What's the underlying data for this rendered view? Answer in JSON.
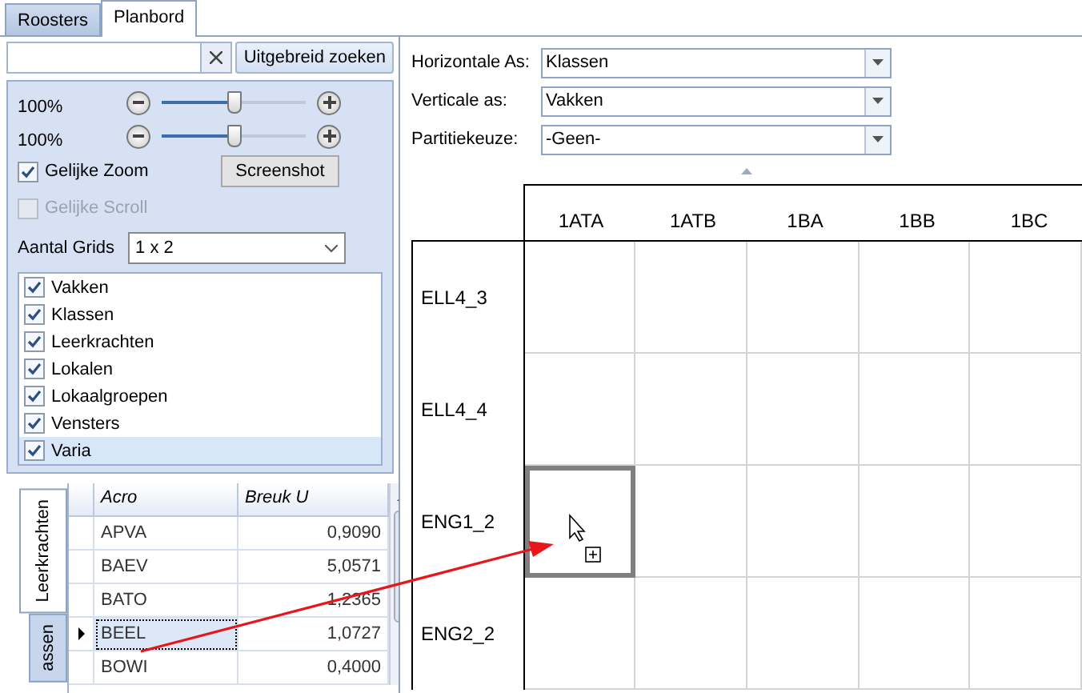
{
  "tabs": [
    {
      "label": "Roosters",
      "selected": false
    },
    {
      "label": "Planbord",
      "selected": true
    }
  ],
  "search": {
    "advanced_button": "Uitgebreid zoeken"
  },
  "zoom": [
    {
      "reading": "100%",
      "level": 0.5
    },
    {
      "reading": "100%",
      "level": 0.5
    }
  ],
  "options": [
    {
      "label": "Gelijke Zoom",
      "checked": true,
      "disabled": false
    },
    {
      "label": "Gelijke Scroll",
      "checked": false,
      "disabled": true
    }
  ],
  "screenshot_button": "Screenshot",
  "grids": {
    "label": "Aantal Grids",
    "value": "1 x 2"
  },
  "layers": [
    {
      "label": "Vakken",
      "checked": true,
      "selected": false
    },
    {
      "label": "Klassen",
      "checked": true,
      "selected": false
    },
    {
      "label": "Leerkrachten",
      "checked": true,
      "selected": false
    },
    {
      "label": "Lokalen",
      "checked": true,
      "selected": false
    },
    {
      "label": "Lokaalgroepen",
      "checked": true,
      "selected": false
    },
    {
      "label": "Vensters",
      "checked": true,
      "selected": false
    },
    {
      "label": "Varia",
      "checked": true,
      "selected": true
    }
  ],
  "side_tabs": [
    {
      "label": "Leerkrachten",
      "selected": true
    },
    {
      "label": "assen",
      "selected": false
    }
  ],
  "table": {
    "columns": [
      "Acro",
      "Breuk U"
    ],
    "rows": [
      {
        "acro": "APVA",
        "breuk": "0,9090",
        "selected": false
      },
      {
        "acro": "BAEV",
        "breuk": "5,0571",
        "selected": false
      },
      {
        "acro": "BATO",
        "breuk": "1,2365",
        "selected": false
      },
      {
        "acro": "BEEL",
        "breuk": "1,0727",
        "selected": true
      },
      {
        "acro": "BOWI",
        "breuk": "0,4000",
        "selected": false
      }
    ]
  },
  "axes": [
    {
      "label": "Horizontale As:",
      "value": "Klassen"
    },
    {
      "label": "Verticale as:",
      "value": "Vakken"
    },
    {
      "label": "Partitiekeuze:",
      "value": "-Geen-"
    }
  ],
  "planboard": {
    "columns": [
      "1ATA",
      "1ATB",
      "1BA",
      "1BB",
      "1BC"
    ],
    "rows": [
      {
        "label": "ELL4_3",
        "cells": [
          {
            "selected": false
          },
          {
            "selected": false
          },
          {
            "selected": false
          },
          {
            "selected": false
          },
          {
            "selected": false
          }
        ]
      },
      {
        "label": "ELL4_4",
        "cells": [
          {
            "selected": false
          },
          {
            "selected": false
          },
          {
            "selected": false
          },
          {
            "selected": false
          },
          {
            "selected": false
          }
        ]
      },
      {
        "label": "ENG1_2",
        "cells": [
          {
            "selected": true
          },
          {
            "selected": false
          },
          {
            "selected": false
          },
          {
            "selected": false
          },
          {
            "selected": false
          }
        ]
      },
      {
        "label": "ENG2_2",
        "cells": [
          {
            "selected": false
          },
          {
            "selected": false
          },
          {
            "selected": false
          },
          {
            "selected": false
          },
          {
            "selected": false
          }
        ]
      }
    ]
  }
}
